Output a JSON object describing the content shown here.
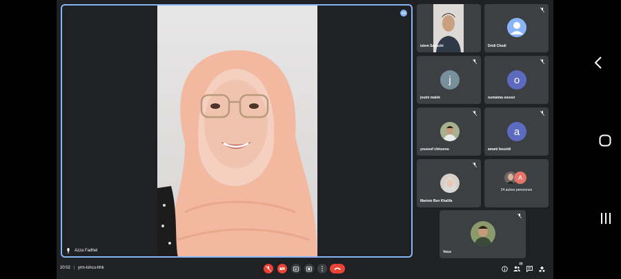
{
  "meeting": {
    "time": "20:02",
    "separator": "|",
    "code": "yrm-lshcu-hhk"
  },
  "main_speaker": {
    "name": "Azza Fadhel"
  },
  "participants": [
    {
      "name": "islem Saouchi",
      "kind": "video"
    },
    {
      "name": "Dridi Chedi",
      "kind": "avatar-icon",
      "color": "#8ab4f8"
    },
    {
      "name": "jouini malek",
      "kind": "letter",
      "letter": "j",
      "color": "#78909c"
    },
    {
      "name": "oumaima soussi",
      "kind": "letter",
      "letter": "o",
      "color": "#5c6bc0"
    },
    {
      "name": "youssef chtourou",
      "kind": "photo"
    },
    {
      "name": "amani bouzidi",
      "kind": "letter",
      "letter": "a",
      "color": "#5c6bc0"
    },
    {
      "name": "Mariem Ben Khalifa",
      "kind": "photo"
    },
    {
      "name": "24 autres personnes",
      "kind": "group",
      "letter": "A"
    },
    {
      "name": "Vous",
      "kind": "photo"
    }
  ],
  "colors": {
    "hangup": "#ea4335",
    "active_border": "#8ab4f8",
    "tile": "#3c4043",
    "bg": "#202124"
  },
  "toolbar": {
    "icons": [
      "mic-off-icon",
      "camera-off-icon",
      "captions-icon",
      "present-icon",
      "more-icon",
      "hangup-icon"
    ],
    "right_icons": [
      "info-icon",
      "people-icon",
      "chat-icon",
      "activities-icon"
    ],
    "people_count": "29"
  }
}
